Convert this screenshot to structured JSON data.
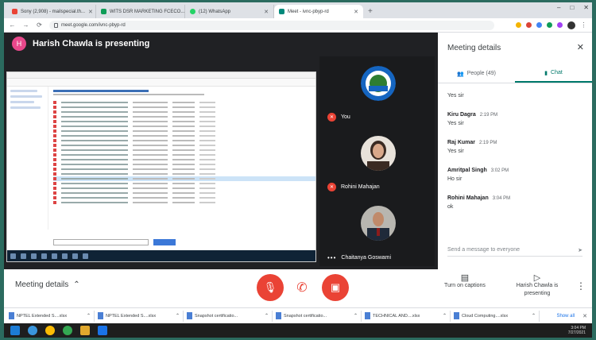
{
  "browser": {
    "tabs": [
      {
        "label": "Sony (2,908) - mailspecial.th...",
        "favicon_color": "#ea4335",
        "active": false
      },
      {
        "label": "WITS DSR MARKETING FCECO...",
        "favicon_color": "#0f9d58",
        "active": false
      },
      {
        "label": "(12) WhatsApp",
        "favicon_color": "#25d366",
        "active": false
      },
      {
        "label": "Meet - ivnc-pbyp-rd",
        "favicon_color": "#00897b",
        "active": true
      }
    ],
    "new_tab": "+",
    "url": "meet.google.com/ivnc-pbyp-rd",
    "window_controls": [
      "–",
      "□",
      "✕"
    ],
    "extension_colors": [
      "#f4b400",
      "#db4437",
      "#4285f4",
      "#0f9d58",
      "#a142f4"
    ]
  },
  "meet": {
    "presenter_initial": "H",
    "presenter_banner": "Harish Chawla is presenting",
    "participants": [
      {
        "name": "You",
        "muted": true
      },
      {
        "name": "Rohini Mahajan",
        "muted": true
      },
      {
        "name": "Chaitanya Goswami",
        "muted": false
      }
    ],
    "logo_text": "GGC",
    "logo_colors": {
      "ring": "#1565c0",
      "center": "#ffffff"
    }
  },
  "panel": {
    "title": "Meeting details",
    "close": "✕",
    "tabs": [
      {
        "label": "People (49)",
        "icon": "people-icon",
        "active": false
      },
      {
        "label": "Chat",
        "icon": "chat-icon",
        "active": true
      }
    ],
    "messages": [
      {
        "sender": "",
        "time": "",
        "text": "Yes sir"
      },
      {
        "sender": "Kiru Dagra",
        "time": "2:19 PM",
        "text": "Yes sir"
      },
      {
        "sender": "Raj Kumar",
        "time": "2:19 PM",
        "text": "Yes sir"
      },
      {
        "sender": "Amritpal Singh",
        "time": "3:02 PM",
        "text": "Ho sir"
      },
      {
        "sender": "Rohini Mahajan",
        "time": "3:04 PM",
        "text": "ok"
      }
    ],
    "input_placeholder": "Send a message to everyone",
    "send_icon": "send-icon"
  },
  "bottom": {
    "meeting_details": "Meeting details",
    "chevron": "⌃",
    "captions_label": "Turn on captions",
    "presenting_label": "Harish Chawla is presenting",
    "more": "⋮"
  },
  "downloads": {
    "items": [
      "NPTEL Extended S....xlsx",
      "NPTEL Extended S....xlsx",
      "Snapshot certificatio...",
      "Snapshot certificatio...",
      "TECHNICAL AND....xlsx",
      "Cloud Computing....xlsx"
    ],
    "show_all": "Show all"
  },
  "taskbar": {
    "icon_colors": [
      "#1c7cd6",
      "#3a96dd",
      "#fbbc05",
      "#34a853",
      "#e0a82e",
      "#1a73e8"
    ],
    "time": "3:04 PM",
    "date": "7/27/2021"
  }
}
